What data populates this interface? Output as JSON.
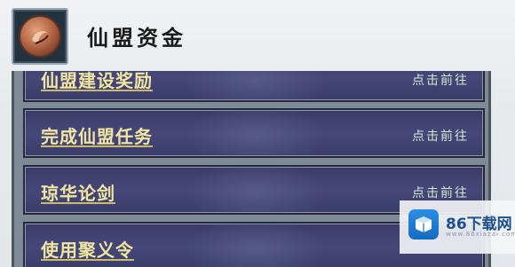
{
  "header": {
    "title": "仙盟资金",
    "emblem_icon": "alliance-emblem-icon"
  },
  "rows": [
    {
      "label": "仙盟建设奖励",
      "action": "点击前往"
    },
    {
      "label": "完成仙盟任务",
      "action": "点击前往"
    },
    {
      "label": "琼华论剑",
      "action": "点击前往"
    },
    {
      "label": "使用聚义令",
      "action": ""
    }
  ],
  "watermark": {
    "text": "86下载网",
    "url": "www.86xiazai.com",
    "icon": "box-logo-icon"
  },
  "colors": {
    "row_label": "#f1e6a0",
    "row_action": "#d6e6cf",
    "row_bg": "#3f4172"
  }
}
